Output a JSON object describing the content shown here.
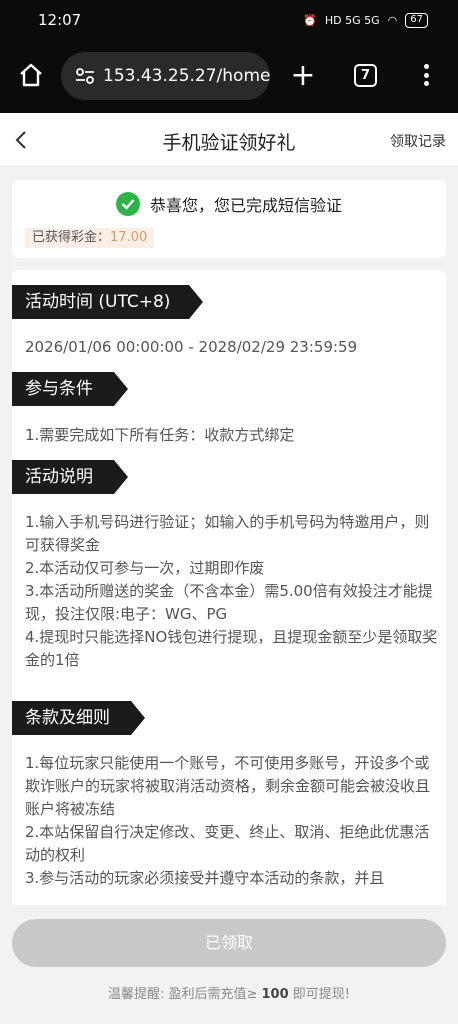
{
  "status_bar": {
    "time": "12:07",
    "network_labels": "HD  5G  5G",
    "battery": "67"
  },
  "browser": {
    "url": "153.43.25.27/home/",
    "tab_count": "7"
  },
  "header": {
    "title": "手机验证领好礼",
    "records_label": "领取记录"
  },
  "success": {
    "message": "恭喜您，您已完成短信验证",
    "bonus_label": "已获得彩金：",
    "bonus_value": "17.00"
  },
  "sections": [
    {
      "title": "活动时间 (UTC+8)",
      "lines": [
        "2026/01/06 00:00:00 - 2028/02/29 23:59:59"
      ]
    },
    {
      "title": "参与条件",
      "lines": [
        "1.需要完成如下所有任务：收款方式绑定"
      ]
    },
    {
      "title": "活动说明",
      "lines": [
        "1.输入手机号码进行验证；如输入的手机号码为特邀用户，则可获得奖金",
        "2.本活动仅可参与一次，过期即作废",
        "3.本活动所赠送的奖金（不含本金）需5.00倍有效投注才能提现，投注仅限:电子：WG、PG",
        "4.提现时只能选择NO钱包进行提现，且提现金额至少是领取奖金的1倍"
      ]
    },
    {
      "title": "条款及细则",
      "lines": [
        "1.每位玩家只能使用一个账号，不可使用多账号，开设多个或欺诈账户的玩家将被取消活动资格，剩余金额可能会被没收且账户将被冻结",
        "2.本站保留自行决定修改、变更、终止、取消、拒绝此优惠活动的权利",
        "3.参与活动的玩家必须接受并遵守本活动的条款，并且"
      ]
    }
  ],
  "footer": {
    "button_label": "已领取",
    "reminder_prefix": "温馨提醒: 盈利后需充值≥ ",
    "reminder_amount": "100",
    "reminder_suffix": " 即可提现!"
  },
  "colors": {
    "success_green": "#2eb34b",
    "bonus_gold": "#c9a26a",
    "label_dark": "#1b1b1b"
  }
}
